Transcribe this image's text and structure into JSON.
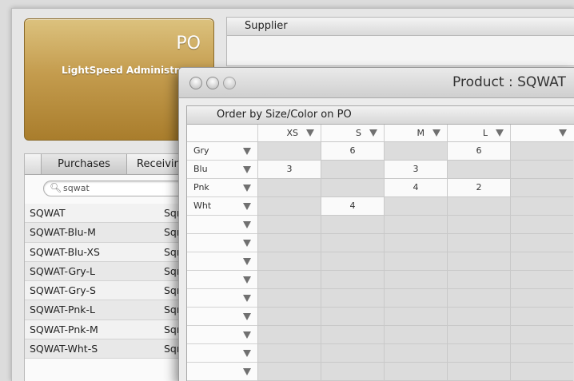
{
  "po_panel": {
    "title": "PO",
    "subtitle": "LightSpeed Administr"
  },
  "supplier": {
    "header": "Supplier"
  },
  "tabs": {
    "purchases": "Purchases",
    "receiving": "Receivin"
  },
  "search": {
    "value": "sqwat"
  },
  "list": [
    {
      "name": "SQWAT",
      "supplier": "Sqı"
    },
    {
      "name": "SQWAT-Blu-M",
      "supplier": "Sqı"
    },
    {
      "name": "SQWAT-Blu-XS",
      "supplier": "Sqı"
    },
    {
      "name": "SQWAT-Gry-L",
      "supplier": "Sqı"
    },
    {
      "name": "SQWAT-Gry-S",
      "supplier": "Sqı"
    },
    {
      "name": "SQWAT-Pnk-L",
      "supplier": "Sqı"
    },
    {
      "name": "SQWAT-Pnk-M",
      "supplier": "Sqı"
    },
    {
      "name": "SQWAT-Wht-S",
      "supplier": "Sqı"
    }
  ],
  "product_window": {
    "title": "Product : SQWAT",
    "grid_title": "Order by Size/Color on PO",
    "sizes": [
      "XS",
      "S",
      "M",
      "L",
      ""
    ],
    "colors": [
      "Gry",
      "Blu",
      "Pnk",
      "Wht",
      "",
      "",
      "",
      "",
      "",
      "",
      "",
      "",
      ""
    ],
    "quantities": [
      [
        "",
        "6",
        "",
        "6",
        ""
      ],
      [
        "3",
        "",
        "3",
        "",
        ""
      ],
      [
        "",
        "",
        "4",
        "2",
        ""
      ],
      [
        "",
        "4",
        "",
        "",
        ""
      ]
    ]
  },
  "colors": {
    "po_gold": "#c49c4e",
    "cell_filled": "#fafafa",
    "cell_empty": "#dcdcdc"
  },
  "icons": [
    "search-icon",
    "clear-search-icon",
    "close-window-icon",
    "minimize-window-icon",
    "zoom-window-icon",
    "dropdown-arrow-icon"
  ]
}
